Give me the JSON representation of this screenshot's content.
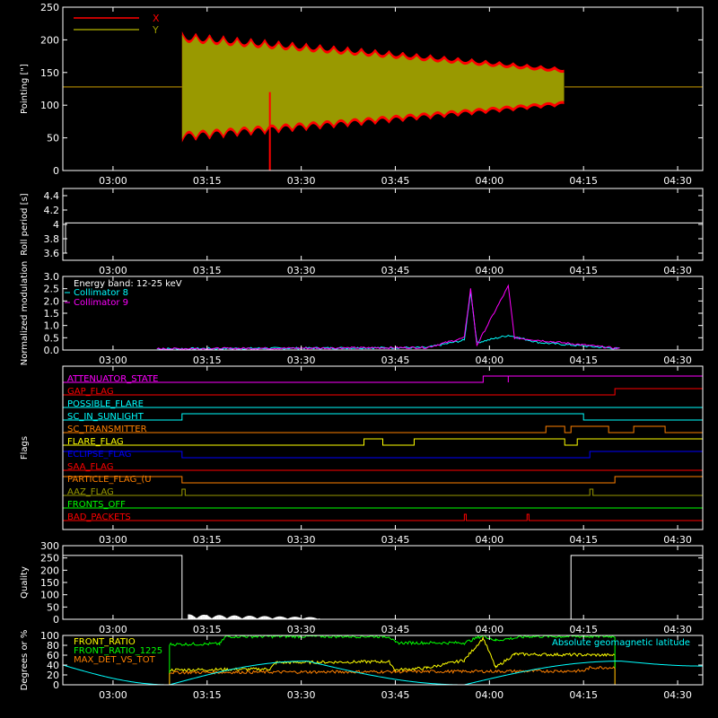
{
  "chart_data": [
    {
      "id": "pointing",
      "type": "line",
      "ylabel": "Pointing [\"]",
      "ylim": [
        0,
        250
      ],
      "yticks": [
        0,
        50,
        100,
        150,
        200,
        250
      ],
      "xlim": [
        "02:52",
        "04:34"
      ],
      "xticks": [
        "03:00",
        "03:15",
        "03:30",
        "03:45",
        "04:00",
        "04:15",
        "04:30"
      ],
      "legend": [
        {
          "name": "X",
          "color": "#ff0000"
        },
        {
          "name": "Y",
          "color": "#999900"
        }
      ],
      "legend_position": "top-left",
      "series": [
        {
          "name": "X",
          "color": "#ff0000",
          "segments": [
            {
              "t": "02:52",
              "center": 128,
              "amp": 0
            },
            {
              "t": "03:11",
              "center": 128,
              "amp": 85
            },
            {
              "t": "03:40",
              "center": 128,
              "amp": 60
            },
            {
              "t": "04:12",
              "center": 128,
              "amp": 30
            }
          ]
        },
        {
          "name": "Y",
          "color": "#999900",
          "segments": [
            {
              "t": "02:52",
              "center": 128,
              "amp": 0
            },
            {
              "t": "03:11",
              "center": 128,
              "amp": 80
            },
            {
              "t": "03:40",
              "center": 128,
              "amp": 55
            },
            {
              "t": "04:12",
              "center": 128,
              "amp": 25
            }
          ]
        }
      ]
    },
    {
      "id": "roll",
      "type": "line",
      "ylabel": "Roll period [s]",
      "ylim": [
        3.5,
        4.5
      ],
      "yticks": [
        3.6,
        3.8,
        4.0,
        4.2,
        4.4
      ],
      "xticks": [
        "03:00",
        "03:15",
        "03:30",
        "03:45",
        "04:00",
        "04:15",
        "04:30"
      ],
      "series": [
        {
          "name": "roll",
          "color": "#ffffff",
          "value": 4.02
        }
      ]
    },
    {
      "id": "modulation",
      "type": "line",
      "ylabel": "Normalized modulation",
      "ylim": [
        0,
        3.0
      ],
      "yticks": [
        "0.0",
        "0.5",
        "1.0",
        "1.5",
        "2.0",
        "2.5",
        "3.0"
      ],
      "xticks": [
        "03:00",
        "03:15",
        "03:30",
        "03:45",
        "04:00",
        "04:15",
        "04:30"
      ],
      "annotation": "Energy band: 12-25 keV",
      "legend": [
        {
          "name": "Collimator 8",
          "color": "#00ffff"
        },
        {
          "name": "Collimator 9",
          "color": "#ff00ff"
        }
      ],
      "legend_position": "top-left",
      "series": [
        {
          "name": "Collimator 8",
          "color": "#00ffff",
          "points": [
            [
              "03:07",
              0.05
            ],
            [
              "03:50",
              0.1
            ],
            [
              "03:56",
              0.4
            ],
            [
              "03:57",
              2.4
            ],
            [
              "03:58",
              0.3
            ],
            [
              "04:03",
              0.6
            ],
            [
              "04:08",
              0.3
            ],
            [
              "04:21",
              0.05
            ]
          ]
        },
        {
          "name": "Collimator 9",
          "color": "#ff00ff",
          "points": [
            [
              "03:07",
              0.05
            ],
            [
              "03:50",
              0.1
            ],
            [
              "03:56",
              0.5
            ],
            [
              "03:57",
              2.5
            ],
            [
              "03:58",
              0.2
            ],
            [
              "04:03",
              2.6
            ],
            [
              "04:04",
              0.5
            ],
            [
              "04:21",
              0.05
            ]
          ]
        }
      ]
    },
    {
      "id": "flags",
      "type": "line",
      "ylabel": "Flags",
      "xticks": [
        "03:00",
        "03:15",
        "03:30",
        "03:45",
        "04:00",
        "04:15",
        "04:30"
      ],
      "flags": [
        {
          "name": "ATTENUATOR_STATE",
          "color": "#ff00ff",
          "on": [
            [
              "03:59",
              "04:03"
            ],
            [
              "04:03",
              "04:34"
            ]
          ],
          "level2": [
            [
              "04:03",
              "04:34"
            ]
          ]
        },
        {
          "name": "GAP_FLAG",
          "color": "#ff0000",
          "on": [
            [
              "04:20",
              "04:34"
            ]
          ]
        },
        {
          "name": "POSSIBLE_FLARE",
          "color": "#00ffff",
          "on": []
        },
        {
          "name": "SC_IN_SUNLIGHT",
          "color": "#00ffff",
          "on": [
            [
              "03:11",
              "04:15"
            ]
          ]
        },
        {
          "name": "SC_TRANSMITTER",
          "color": "#ff8000",
          "on": [
            [
              "04:09",
              "04:12"
            ],
            [
              "04:13",
              "04:19"
            ],
            [
              "04:23",
              "04:28"
            ]
          ]
        },
        {
          "name": "FLARE_FLAG",
          "color": "#ffff00",
          "on": [
            [
              "03:40",
              "03:43"
            ],
            [
              "03:48",
              "04:12"
            ],
            [
              "04:14",
              "04:34"
            ]
          ]
        },
        {
          "name": "ECLIPSE_FLAG",
          "color": "#0000ff",
          "on": [
            [
              "02:52",
              "03:11"
            ],
            [
              "04:16",
              "04:34"
            ]
          ]
        },
        {
          "name": "SAA_FLAG",
          "color": "#ff0000",
          "on": []
        },
        {
          "name": "PARTICLE_FLAG_(U",
          "color": "#ff8000",
          "on": [
            [
              "02:52",
              "03:11"
            ],
            [
              "04:20",
              "04:34"
            ]
          ]
        },
        {
          "name": "AAZ_FLAG",
          "color": "#999900",
          "on": [
            [
              "03:11",
              "03:11.5"
            ],
            [
              "04:16",
              "04:16.5"
            ]
          ]
        },
        {
          "name": "FRONTS_OFF",
          "color": "#00ff00",
          "on": []
        },
        {
          "name": "BAD_PACKETS",
          "color": "#ff0000",
          "on": [
            [
              "03:56",
              "03:56.3"
            ],
            [
              "04:06",
              "04:06.3"
            ]
          ]
        }
      ]
    },
    {
      "id": "quality",
      "type": "line",
      "ylabel": "Quality",
      "ylim": [
        0,
        300
      ],
      "yticks": [
        0,
        50,
        100,
        150,
        200,
        250,
        300
      ],
      "xticks": [
        "03:00",
        "03:15",
        "03:30",
        "03:45",
        "04:00",
        "04:15",
        "04:30"
      ],
      "series": [
        {
          "name": "quality",
          "color": "#ffffff",
          "points": [
            [
              "02:52",
              0
            ],
            [
              "02:52",
              260
            ],
            [
              "03:11",
              260
            ],
            [
              "03:11",
              0
            ],
            [
              "04:13",
              0
            ],
            [
              "04:13",
              260
            ],
            [
              "04:34",
              260
            ]
          ],
          "noise": [
            [
              "03:12",
              "03:33",
              20
            ]
          ]
        }
      ]
    },
    {
      "id": "ratios",
      "type": "line",
      "ylabel": "Degrees or %",
      "ylim": [
        0,
        100
      ],
      "yticks": [
        0,
        20,
        40,
        60,
        80,
        100
      ],
      "xticks": [
        "03:00",
        "03:15",
        "03:30",
        "03:45",
        "04:00",
        "04:15",
        "04:30"
      ],
      "legend": [
        {
          "name": "FRONT_RATIO",
          "color": "#ffff00"
        },
        {
          "name": "FRONT_RATIO_1225",
          "color": "#00ff00"
        },
        {
          "name": "MAX_DET_VS_TOT",
          "color": "#ff8000"
        }
      ],
      "legend_position": "top-left",
      "annotation": "Absolute geomagnetic latitude",
      "annotation_color": "#00ffff",
      "series": [
        {
          "name": "FRONT_RATIO",
          "color": "#ffff00",
          "points": [
            [
              "03:09",
              30
            ],
            [
              "03:25",
              32
            ],
            [
              "03:26",
              45
            ],
            [
              "03:44",
              47
            ],
            [
              "03:45",
              30
            ],
            [
              "03:50",
              34
            ],
            [
              "03:56",
              50
            ],
            [
              "03:59",
              95
            ],
            [
              "04:01",
              35
            ],
            [
              "04:04",
              62
            ],
            [
              "04:20",
              60
            ]
          ]
        },
        {
          "name": "FRONT_RATIO_1225",
          "color": "#00ff00",
          "points": [
            [
              "03:09",
              82
            ],
            [
              "03:17",
              83
            ],
            [
              "03:18",
              98
            ],
            [
              "03:44",
              98
            ],
            [
              "03:45",
              85
            ],
            [
              "03:56",
              85
            ],
            [
              "03:59",
              100
            ],
            [
              "04:01",
              90
            ],
            [
              "04:06",
              98
            ],
            [
              "04:20",
              98
            ]
          ]
        },
        {
          "name": "MAX_DET_VS_TOT",
          "color": "#ff8000",
          "points": [
            [
              "03:09",
              25
            ],
            [
              "04:15",
              28
            ],
            [
              "04:16",
              35
            ],
            [
              "04:20",
              35
            ]
          ]
        },
        {
          "name": "Absolute geomagnetic latitude",
          "color": "#00ffff",
          "points": [
            [
              "02:52",
              40
            ],
            [
              "03:09",
              0
            ],
            [
              "03:31",
              48
            ],
            [
              "03:56",
              0
            ],
            [
              "04:21",
              48
            ],
            [
              "04:34",
              38
            ]
          ]
        }
      ]
    }
  ]
}
